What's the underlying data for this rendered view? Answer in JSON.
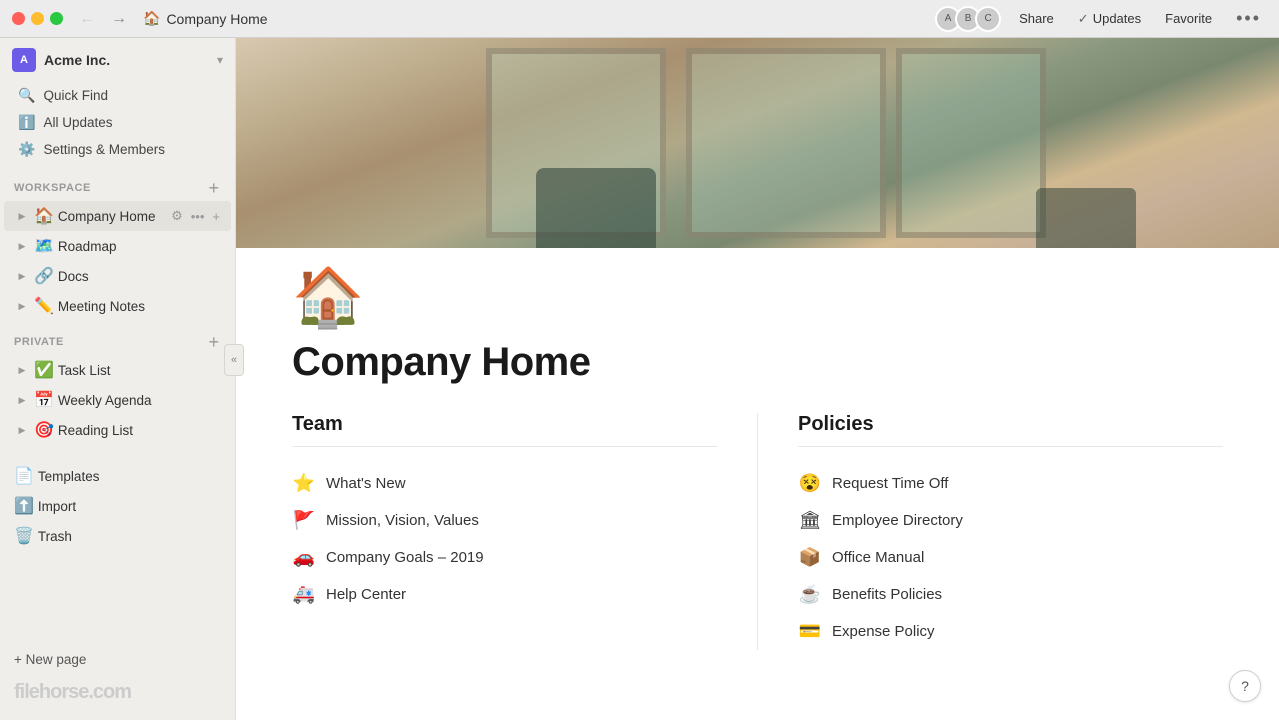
{
  "titlebar": {
    "page_icon": "🏠",
    "page_title": "Company Home",
    "back_arrow": "←",
    "forward_arrow": "→",
    "share_label": "Share",
    "updates_label": "Updates",
    "favorite_label": "Favorite",
    "more_label": "•••"
  },
  "sidebar": {
    "workspace_name": "Acme Inc.",
    "workspace_chevron": "▾",
    "nav_items": [
      {
        "id": "quick-find",
        "icon": "🔍",
        "label": "Quick Find"
      },
      {
        "id": "all-updates",
        "icon": "ℹ",
        "label": "All Updates"
      },
      {
        "id": "settings",
        "icon": "⚙",
        "label": "Settings & Members"
      }
    ],
    "workspace_section": "WORKSPACE",
    "workspace_items": [
      {
        "id": "company-home",
        "icon": "🏠",
        "label": "Company Home",
        "active": true
      },
      {
        "id": "roadmap",
        "icon": "🗺",
        "label": "Roadmap"
      },
      {
        "id": "docs",
        "icon": "🔗",
        "label": "Docs"
      },
      {
        "id": "meeting-notes",
        "icon": "✏",
        "label": "Meeting Notes"
      }
    ],
    "private_section": "PRIVATE",
    "private_items": [
      {
        "id": "task-list",
        "icon": "✅",
        "label": "Task List"
      },
      {
        "id": "weekly-agenda",
        "icon": "📅",
        "label": "Weekly Agenda"
      },
      {
        "id": "reading-list",
        "icon": "🎯",
        "label": "Reading List"
      }
    ],
    "bottom_items": [
      {
        "id": "templates",
        "icon": "📄",
        "label": "Templates"
      },
      {
        "id": "import",
        "icon": "⬆",
        "label": "Import"
      },
      {
        "id": "trash",
        "icon": "🗑",
        "label": "Trash"
      }
    ],
    "new_page_label": "+ New page",
    "collapse_icon": "«"
  },
  "page": {
    "icon": "🏠",
    "title": "Company Home",
    "team_section": {
      "title": "Team",
      "links": [
        {
          "emoji": "⭐",
          "label": "What's New"
        },
        {
          "emoji": "🚩",
          "label": "Mission, Vision, Values"
        },
        {
          "emoji": "🚗",
          "label": "Company Goals – 2019"
        },
        {
          "emoji": "🚑",
          "label": "Help Center"
        }
      ]
    },
    "policies_section": {
      "title": "Policies",
      "links": [
        {
          "emoji": "😵",
          "label": "Request Time Off"
        },
        {
          "emoji": "🏛",
          "label": "Employee Directory"
        },
        {
          "emoji": "📦",
          "label": "Office Manual"
        },
        {
          "emoji": "☕",
          "label": "Benefits Policies"
        },
        {
          "emoji": "💳",
          "label": "Expense Policy"
        }
      ]
    }
  },
  "help_btn": "?",
  "watermark": "filehorse.com"
}
